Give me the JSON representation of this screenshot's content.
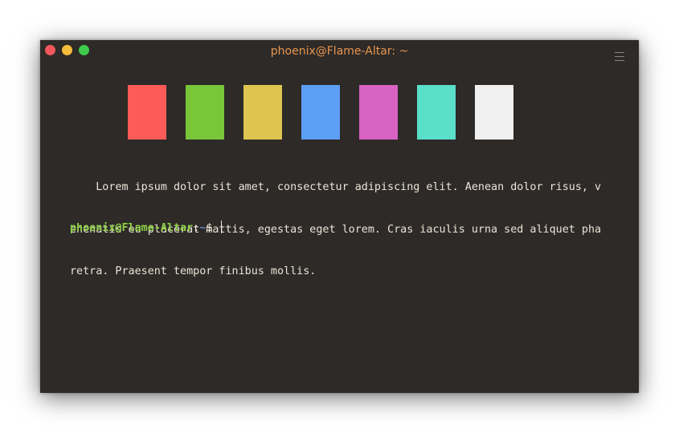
{
  "window": {
    "title": "phoenix@Flame-Altar: ~"
  },
  "titlebar": {
    "buttons": [
      {
        "name": "close-button",
        "color": "#f0585b"
      },
      {
        "name": "minimize-button",
        "color": "#f6bd3b"
      },
      {
        "name": "maximize-button",
        "color": "#3fcb4b"
      }
    ],
    "menu_icon": "hamburger-menu-icon"
  },
  "palette": {
    "colors": [
      "#fd5b57",
      "#79c638",
      "#ddc550",
      "#5c9ff5",
      "#d862c2",
      "#5adfcb",
      "#f0f0f0"
    ]
  },
  "terminal": {
    "output_lines": [
      "    Lorem ipsum dolor sit amet, consectetur adipiscing elit. Aenean dolor risus, v",
      "enenatis eu placerat mattis, egestas eget lorem. Cras iaculis urna sed aliquet pha",
      "retra. Praesent tempor finibus mollis."
    ],
    "prompt": {
      "user_host": "phoenix@Flame-Altar",
      "colon": ":",
      "path": "~",
      "symbol": "$ "
    }
  }
}
